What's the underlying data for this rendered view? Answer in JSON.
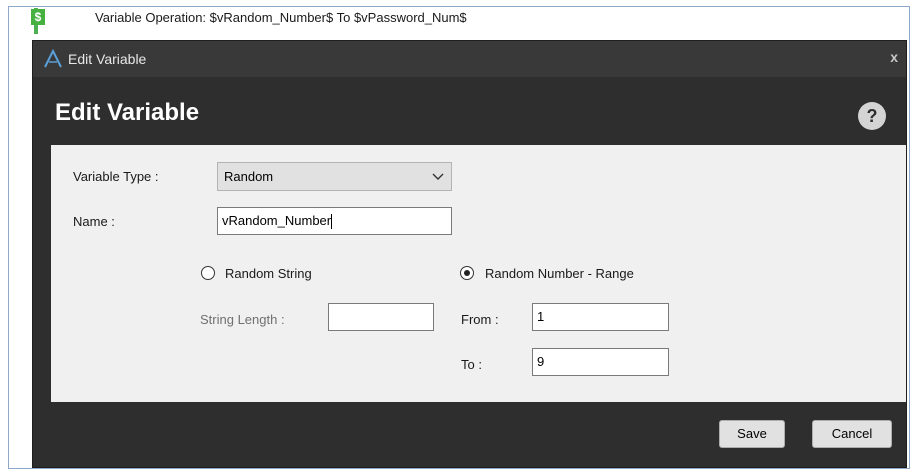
{
  "background_node": {
    "icon": "dollar-icon",
    "icon_glyph": "$",
    "text": "Variable Operation: $vRandom_Number$ To $vPassword_Num$"
  },
  "window": {
    "title": "Edit Variable",
    "close_glyph": "x"
  },
  "header": {
    "title": "Edit Variable",
    "help_glyph": "?"
  },
  "form": {
    "variable_type_label": "Variable Type :",
    "variable_type_value": "Random",
    "name_label": "Name :",
    "name_value": "vRandom_Number",
    "random_string_label": "Random String",
    "random_string_selected": false,
    "string_length_label": "String Length :",
    "string_length_value": "",
    "random_number_label": "Random Number - Range",
    "random_number_selected": true,
    "from_label": "From :",
    "from_value": "1",
    "to_label": "To :",
    "to_value": "9"
  },
  "buttons": {
    "save": "Save",
    "cancel": "Cancel"
  },
  "colors": {
    "dialog_bg": "#2e2e2e",
    "panel_bg": "#f0f0f0",
    "accent_green": "#46b040",
    "app_icon_blue": "#5aa0d8"
  }
}
